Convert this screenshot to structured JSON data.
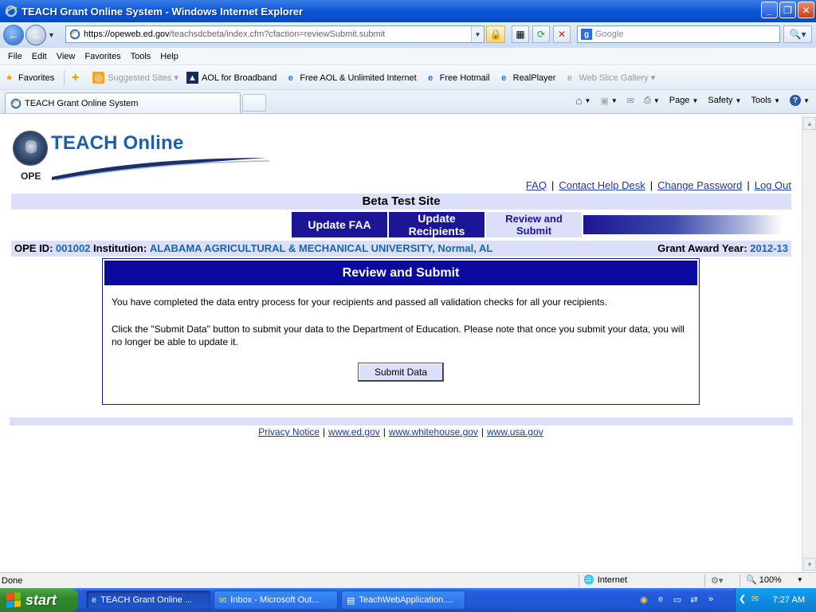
{
  "window": {
    "title": "TEACH Grant Online System - Windows Internet Explorer"
  },
  "addressbar": {
    "url_host": "https://opeweb.ed.gov",
    "url_path": "/teachsdcbeta/index.cfm?cfaction=reviewSubmit.submit",
    "search_placeholder": "Google"
  },
  "menu": [
    "File",
    "Edit",
    "View",
    "Favorites",
    "Tools",
    "Help"
  ],
  "favorites": {
    "label": "Favorites",
    "items": [
      {
        "label": "Suggested Sites ▾"
      },
      {
        "label": "AOL for Broadband"
      },
      {
        "label": "Free AOL & Unlimited Internet"
      },
      {
        "label": "Free Hotmail"
      },
      {
        "label": "RealPlayer"
      },
      {
        "label": "Web Slice Gallery ▾"
      }
    ]
  },
  "tab": {
    "label": "TEACH Grant Online System"
  },
  "commandbar": {
    "page": "Page",
    "safety": "Safety",
    "tools": "Tools"
  },
  "site": {
    "logo_title": "TEACH Online",
    "logo_sub": "OPE",
    "links": [
      "FAQ",
      "Contact Help Desk",
      "Change Password",
      "Log Out"
    ],
    "beta": "Beta Test Site",
    "nav": {
      "update_faa": "Update FAA",
      "update_recipients": "Update Recipients",
      "review_submit_1": "Review and",
      "review_submit_2": "Submit"
    },
    "info": {
      "ope_label": "OPE ID:",
      "ope_value": "001002",
      "inst_label": "Institution:",
      "inst_value": "ALABAMA AGRICULTURAL & MECHANICAL UNIVERSITY, Normal, AL",
      "year_label": "Grant Award Year:",
      "year_value": "2012-13"
    },
    "panel": {
      "title": "Review and Submit",
      "p1": "You have completed the data entry process for your recipients and passed all validation checks for all your recipients.",
      "p2": "Click the \"Submit Data\" button to submit your data to the Department of Education. Please note that once you submit your data, you will no longer be able to update it.",
      "button": "Submit Data"
    },
    "footer": [
      "Privacy Notice",
      "www.ed.gov",
      "www.whitehouse.gov",
      "www.usa.gov"
    ]
  },
  "status": {
    "left": "Done",
    "zone": "Internet",
    "zoom": "100%"
  },
  "taskbar": {
    "start": "start",
    "items": [
      "TEACH Grant Online ...",
      "Inbox - Microsoft Out...",
      "TeachWebApplication...."
    ],
    "clock": "7:27 AM"
  },
  "colors": {
    "site_blue": "#1c1696",
    "panel_head": "#0a0aa0",
    "light_band": "#dbdff7",
    "link": "#1a3a9c",
    "logo_blue": "#1f5fa8"
  }
}
